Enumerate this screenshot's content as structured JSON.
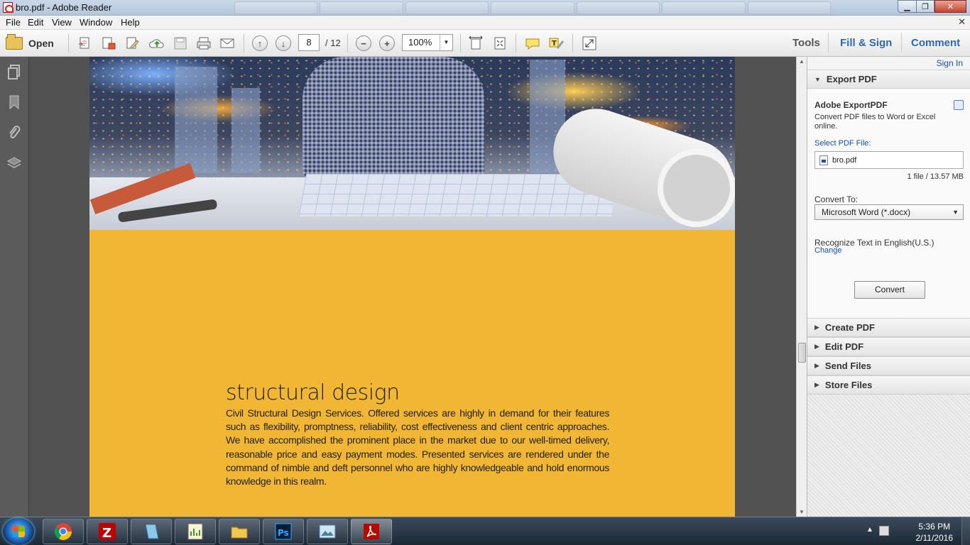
{
  "window": {
    "title": "bro.pdf - Adobe Reader",
    "controls": {
      "minimize": "▁",
      "maximize": "❐",
      "close": "✕"
    }
  },
  "menu": [
    "File",
    "Edit",
    "View",
    "Window",
    "Help"
  ],
  "toolbar": {
    "open_label": "Open",
    "page_current": "8",
    "page_total": "/ 12",
    "zoom": "100%",
    "tools_label": "Tools",
    "fill_sign_label": "Fill & Sign",
    "comment_label": "Comment"
  },
  "document": {
    "section_title": "structural design",
    "section_body": "Civil Structural Design Services. Offered services are highly in demand for their features such as flexibility, promptness, reliability, cost effectiveness and client centric approaches. We have accomplished the prominent place in the market due to our well-timed delivery, reasonable price and easy payment modes. Presented services are rendered under the command of nimble and deft personnel who are highly knowledgeable and hold enormous knowledge in this realm."
  },
  "panel": {
    "sign_in": "Sign In",
    "export": {
      "header": "Export PDF",
      "title": "Adobe ExportPDF",
      "description": "Convert PDF files to Word or Excel online.",
      "select_label": "Select PDF File:",
      "file_name": "bro.pdf",
      "file_info": "1 file / 13.57 MB",
      "convert_to_label": "Convert To:",
      "convert_to_value": "Microsoft Word (*.docx)",
      "recognize_text": "Recognize Text in English(U.S.)",
      "change_link": "Change",
      "convert_button": "Convert"
    },
    "sections": [
      "Create PDF",
      "Edit PDF",
      "Send Files",
      "Store Files"
    ]
  },
  "taskbar": {
    "time": "5:36 PM",
    "date": "2/11/2016",
    "apps": [
      "chrome",
      "filezilla",
      "notepad-app",
      "chart-app",
      "file-explorer",
      "photoshop",
      "image-viewer",
      "adobe-reader"
    ]
  },
  "colors": {
    "page_accent": "#f1b633",
    "link_blue": "#1552a8",
    "panel_bg": "#f4f4f4",
    "doc_bg": "#525252"
  }
}
